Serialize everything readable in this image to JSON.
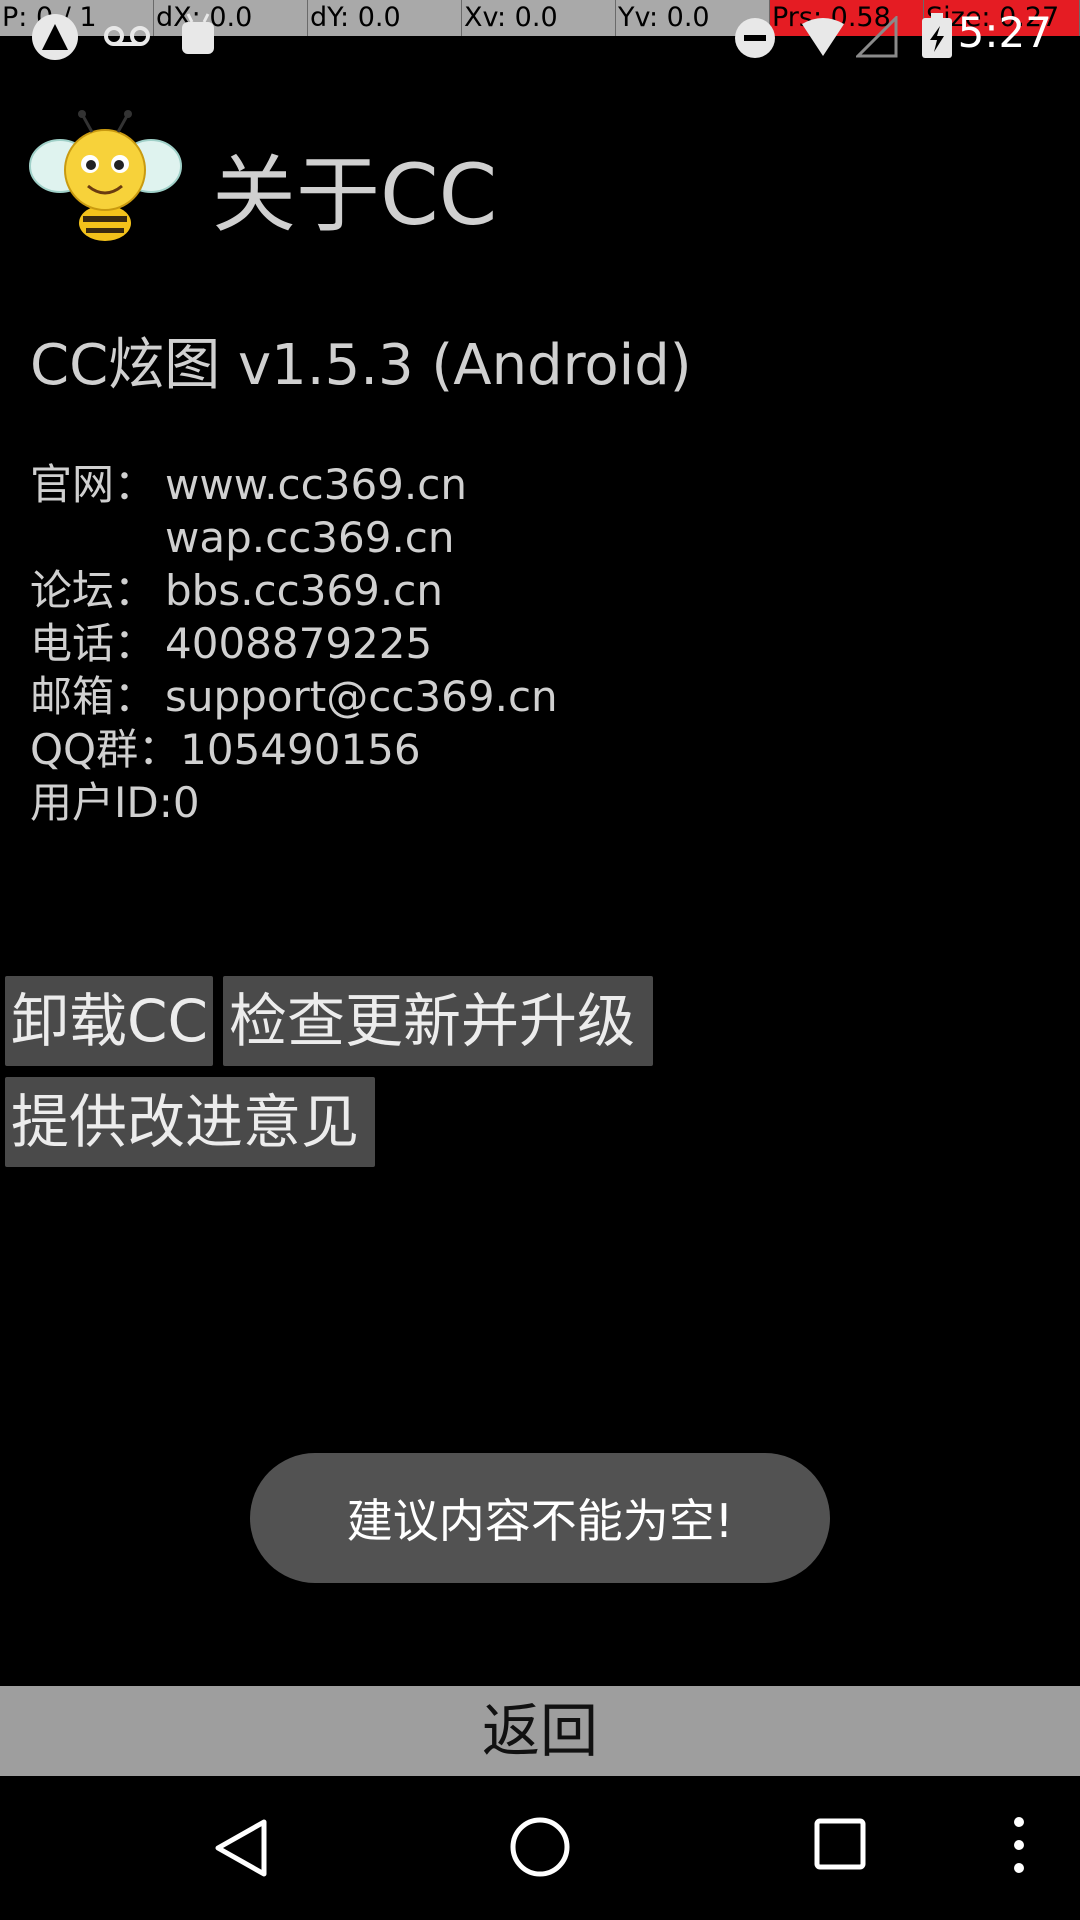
{
  "debug_bar": {
    "cells": [
      {
        "text": "P: 0 / 1",
        "highlight": false
      },
      {
        "text": "dX: 0.0",
        "highlight": false
      },
      {
        "text": "dY: 0.0",
        "highlight": false
      },
      {
        "text": "Xv: 0.0",
        "highlight": false
      },
      {
        "text": "Yv: 0.0",
        "highlight": false
      },
      {
        "text": "Prs: 0.58",
        "highlight": true
      },
      {
        "text": "Size: 0.27",
        "highlight": true
      }
    ]
  },
  "status_bar": {
    "clock": "5:27",
    "icons": [
      "app-notification-icon",
      "voicemail-icon",
      "android-icon",
      "do-not-disturb-icon",
      "wifi-icon",
      "cell-signal-icon",
      "battery-charging-icon"
    ]
  },
  "header": {
    "title": "关于CC",
    "logo": "bee-logo-icon"
  },
  "version": "CC炫图 v1.5.3 (Android)",
  "info": {
    "website_label": "官网：",
    "website_1": "www.cc369.cn",
    "website_2": "wap.cc369.cn",
    "forum_label": "论坛：",
    "forum": "bbs.cc369.cn",
    "phone_label": "电话：",
    "phone": "4008879225",
    "email_label": "邮箱：",
    "email": "support@cc369.cn",
    "qq_label": "QQ群：",
    "qq": "105490156",
    "user_id": "用户ID:0"
  },
  "buttons": {
    "uninstall": "卸载CC",
    "update": "检查更新并升级",
    "feedback": "提供改进意见"
  },
  "toast": "建议内容不能为空!",
  "back_button": "返回",
  "nav": {
    "icons": [
      "back-triangle-icon",
      "home-circle-icon",
      "recents-square-icon",
      "more-vert-icon"
    ]
  },
  "colors": {
    "background": "#000000",
    "button_bg": "#4a4a4a",
    "back_bar_bg": "#9e9e9e",
    "toast_bg": "#525252",
    "debug_highlight": "#e51c23"
  }
}
